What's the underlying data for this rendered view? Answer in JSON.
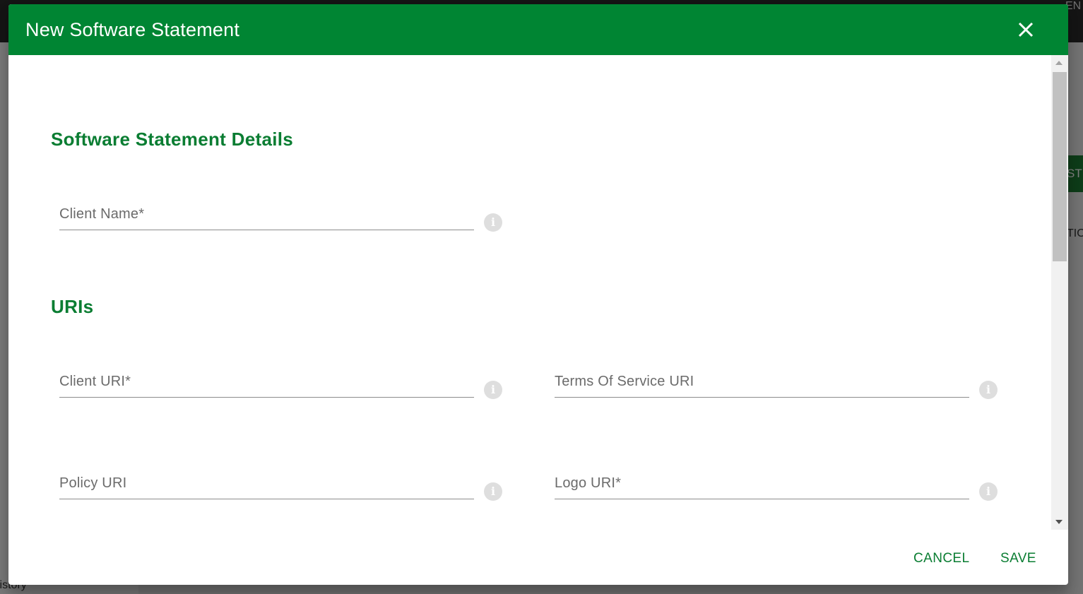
{
  "dialog": {
    "title": "New Software Statement",
    "close_icon": "close-icon"
  },
  "sections": {
    "details_title": "Software Statement Details",
    "uris_title": "URIs"
  },
  "fields": {
    "client_name": {
      "label": "Client Name*",
      "value": ""
    },
    "client_uri": {
      "label": "Client URI*",
      "value": ""
    },
    "terms_of_service_uri": {
      "label": "Terms Of Service URI",
      "value": ""
    },
    "policy_uri": {
      "label": "Policy URI",
      "value": ""
    },
    "logo_uri": {
      "label": "Logo URI*",
      "value": ""
    }
  },
  "info_icon": "info-icon",
  "actions": {
    "cancel_label": "CANCEL",
    "save_label": "SAVE"
  },
  "background": {
    "right_button_fragment": "ST",
    "right_text_fragment": "TIO",
    "language": "EN",
    "sidebar_fragment": "listory"
  },
  "colors": {
    "header": "#008533",
    "accent_text": "#0a7d32"
  }
}
